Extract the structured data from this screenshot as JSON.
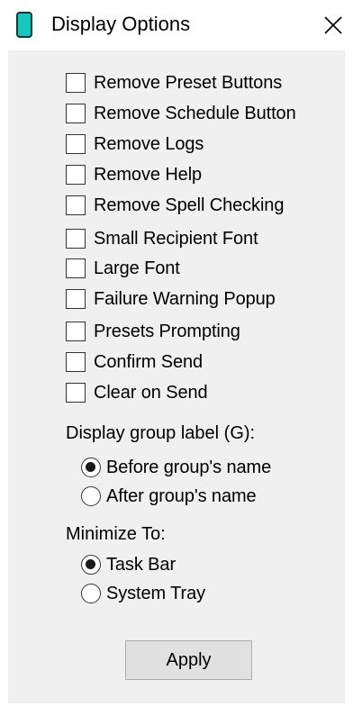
{
  "window": {
    "title": "Display Options",
    "icon": "phone-icon",
    "close_icon": "close-icon"
  },
  "colors": {
    "panel_bg": "#f0f0f0",
    "icon_teal": "#16c7c0",
    "button_bg": "#e1e1e1"
  },
  "options": [
    {
      "label": "Remove Preset Buttons",
      "checked": false
    },
    {
      "label": "Remove Schedule Button",
      "checked": false
    },
    {
      "label": "Remove Logs",
      "checked": false
    },
    {
      "label": "Remove Help",
      "checked": false
    },
    {
      "label": "Remove Spell Checking",
      "checked": false
    },
    {
      "label": "Small Recipient Font",
      "checked": false
    },
    {
      "label": "Large Font",
      "checked": false
    },
    {
      "label": "Failure Warning Popup",
      "checked": false
    },
    {
      "label": "Presets Prompting",
      "checked": false
    },
    {
      "label": "Confirm Send",
      "checked": false
    },
    {
      "label": "Clear on Send",
      "checked": false
    }
  ],
  "group_label": {
    "heading": "Display group label (G):",
    "options": [
      {
        "label": "Before group's name",
        "selected": true
      },
      {
        "label": "After group's name",
        "selected": false
      }
    ]
  },
  "minimize": {
    "heading": "Minimize To:",
    "options": [
      {
        "label": "Task Bar",
        "selected": true
      },
      {
        "label": "System Tray",
        "selected": false
      }
    ]
  },
  "apply_label": "Apply"
}
